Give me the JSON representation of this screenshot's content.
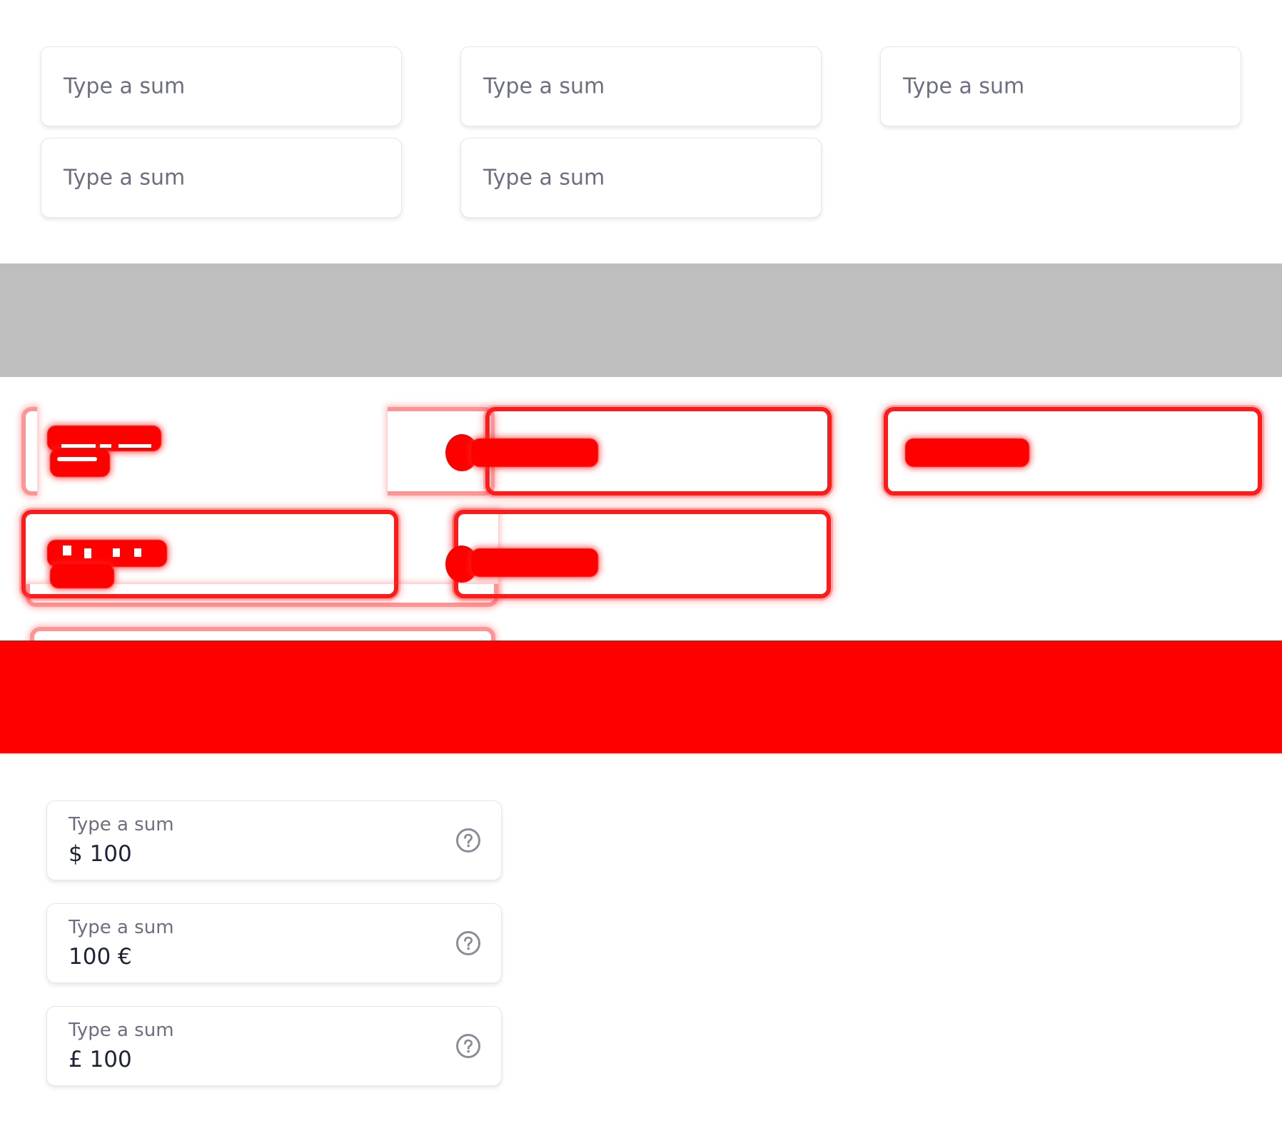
{
  "colors": {
    "field_border": "#e6e7ec",
    "placeholder_text": "#6b6f80",
    "value_text": "#1e2235",
    "grey_band": "#bebebe",
    "error_red": "#ff0000",
    "help_icon": "#8a8d99"
  },
  "empty_fields": [
    {
      "placeholder": "Type a sum"
    },
    {
      "placeholder": "Type a sum"
    },
    {
      "placeholder": "Type a sum"
    },
    {
      "placeholder": "Type a sum"
    },
    {
      "placeholder": "Type a sum"
    }
  ],
  "filled_fields": [
    {
      "label": "Type a sum",
      "value": "$ 100",
      "icon": "help-circle-icon"
    },
    {
      "label": "Type a sum",
      "value": "100 €",
      "icon": "help-circle-icon"
    },
    {
      "label": "Type a sum",
      "value": "£ 100",
      "icon": "help-circle-icon"
    }
  ]
}
